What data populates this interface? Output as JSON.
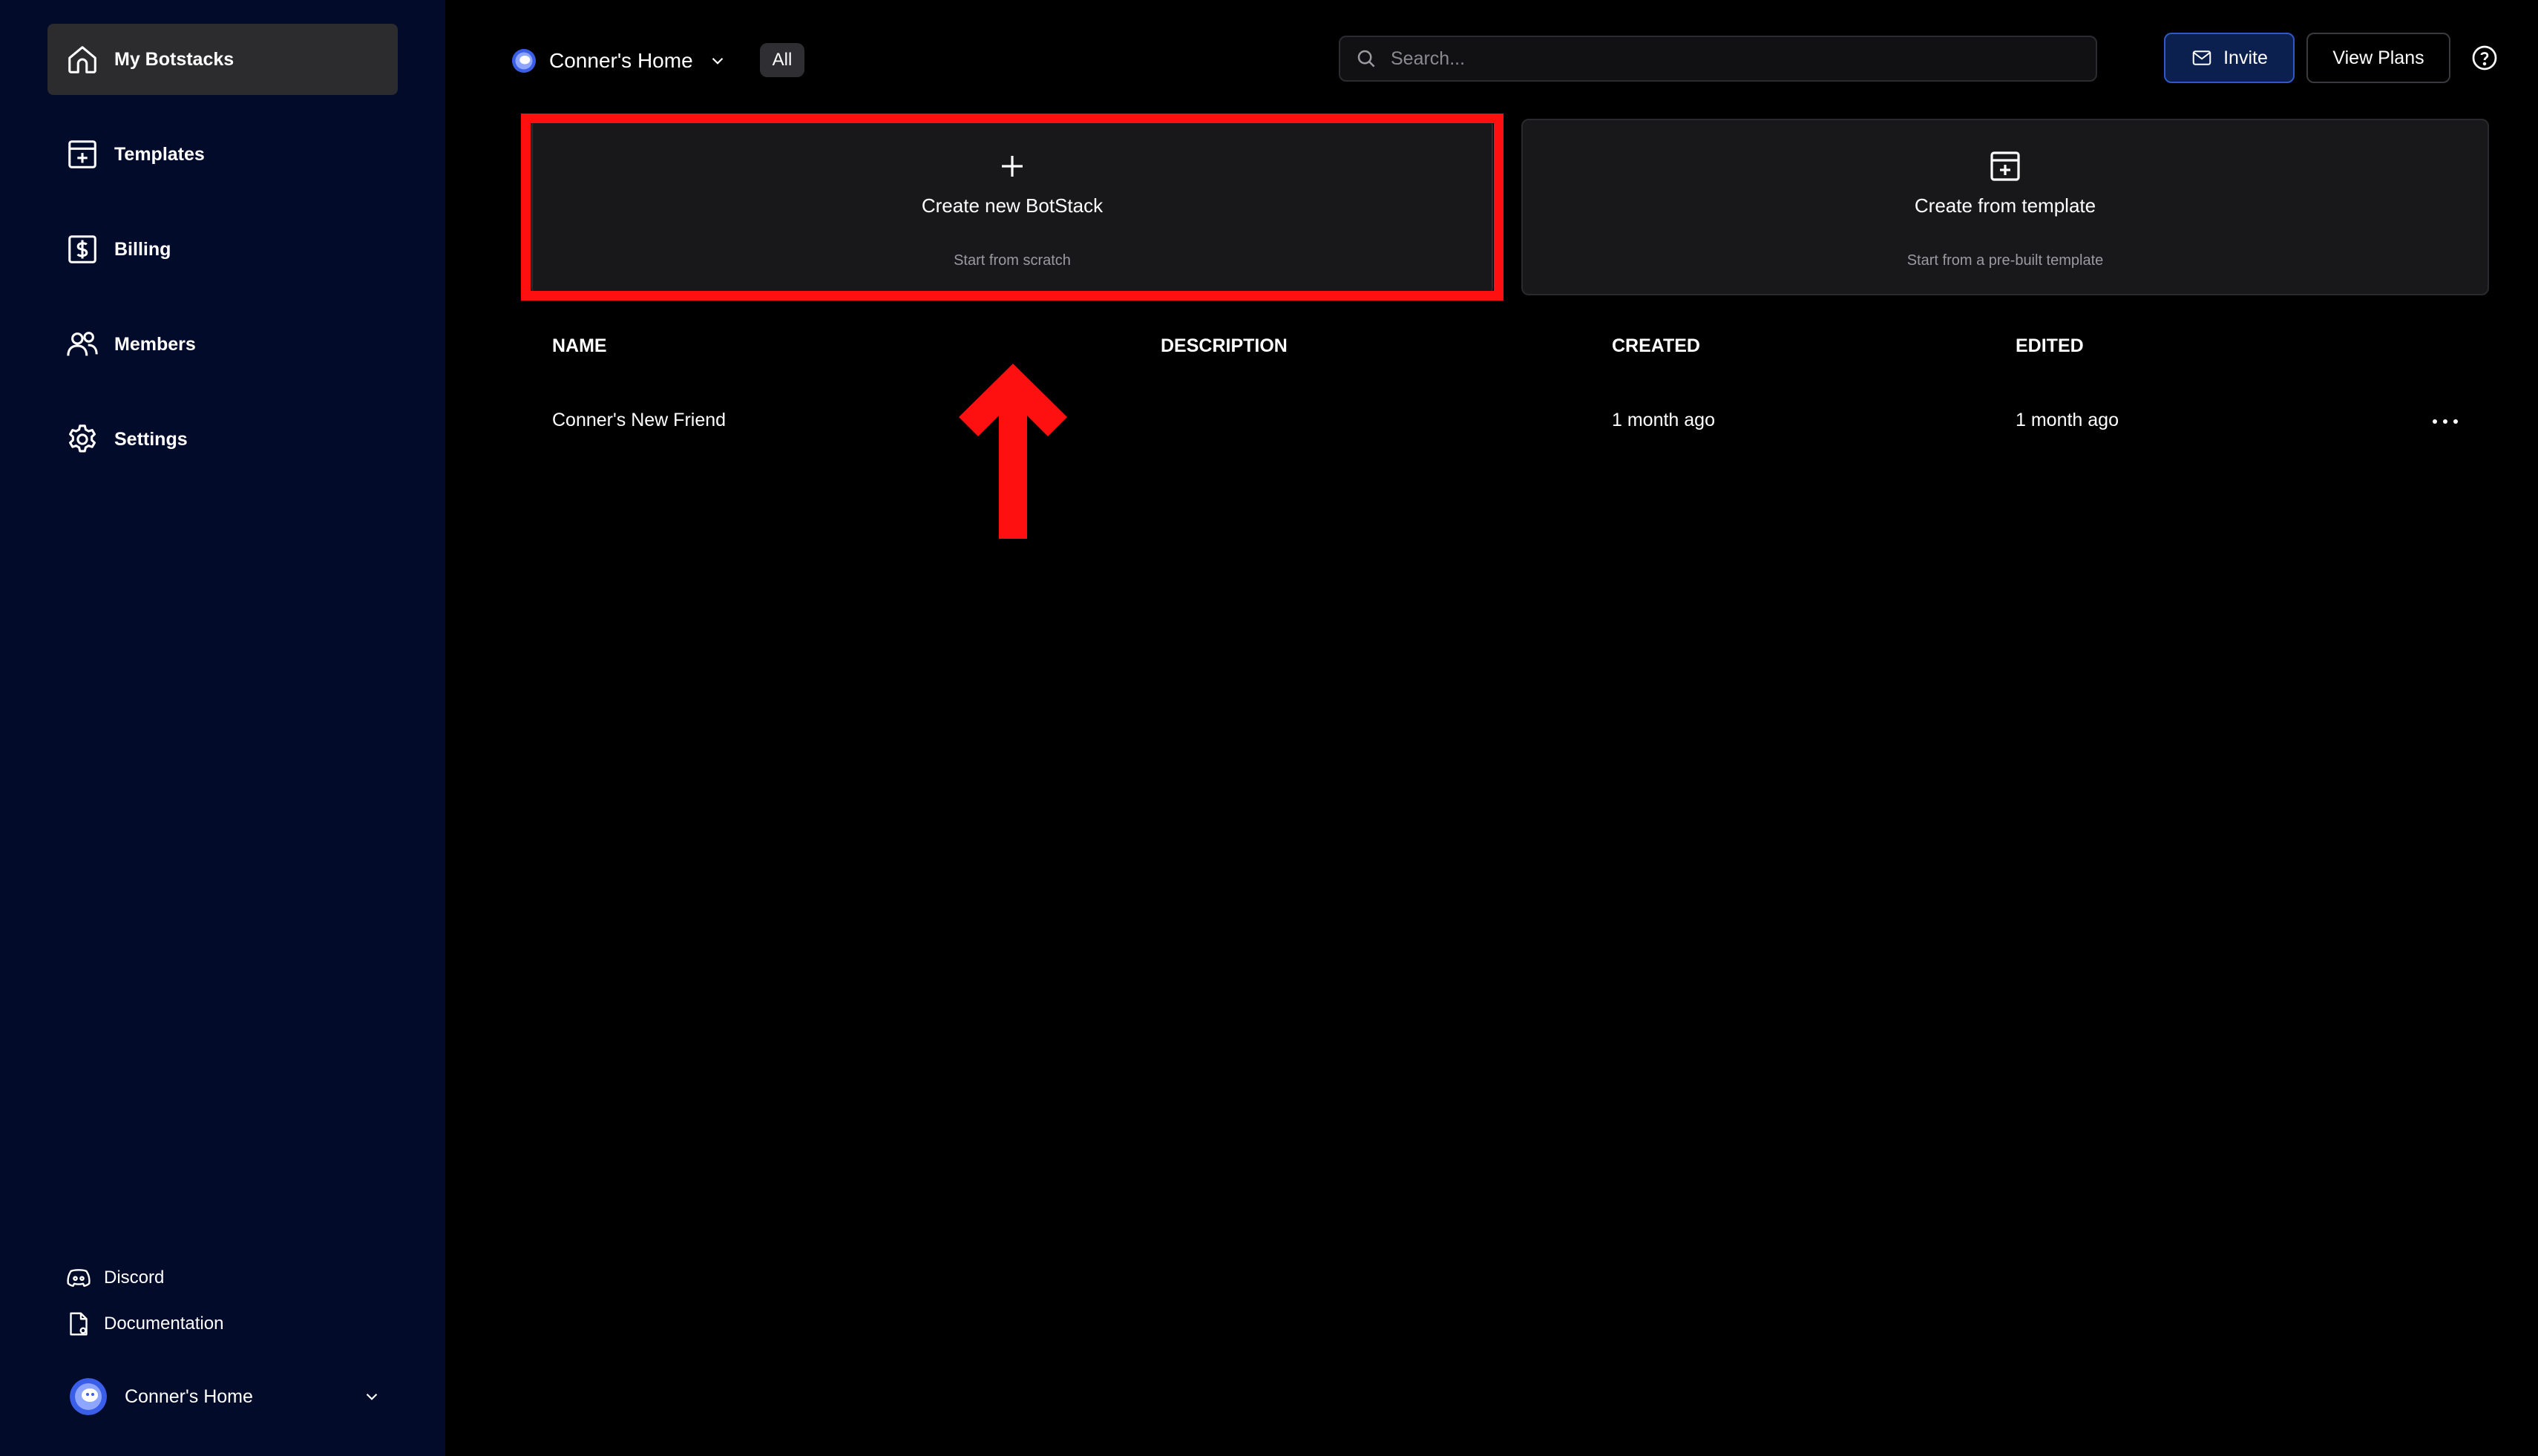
{
  "sidebar": {
    "nav": [
      {
        "label": "My Botstacks",
        "icon": "home-icon",
        "active": true
      },
      {
        "label": "Templates",
        "icon": "template-icon"
      },
      {
        "label": "Billing",
        "icon": "dollar-icon"
      },
      {
        "label": "Members",
        "icon": "users-icon"
      },
      {
        "label": "Settings",
        "icon": "gear-icon"
      }
    ],
    "footer": {
      "discord": "Discord",
      "documentation": "Documentation",
      "workspace": "Conner's Home"
    }
  },
  "header": {
    "workspace": "Conner's Home",
    "filter": "All",
    "search_placeholder": "Search...",
    "invite_label": "Invite",
    "plans_label": "View Plans"
  },
  "cards": {
    "new": {
      "title": "Create new BotStack",
      "subtitle": "Start from scratch"
    },
    "template": {
      "title": "Create from template",
      "subtitle": "Start from a pre-built template"
    }
  },
  "table": {
    "columns": [
      "NAME",
      "DESCRIPTION",
      "CREATED",
      "EDITED"
    ],
    "rows": [
      {
        "name": "Conner's New Friend",
        "description": "",
        "created": "1 month ago",
        "edited": "1 month ago"
      }
    ]
  },
  "colors": {
    "sidebar_bg": "#030b2b",
    "highlight": "#ff1010",
    "invite_bg": "#0c2050",
    "invite_border": "#2f58c9"
  }
}
